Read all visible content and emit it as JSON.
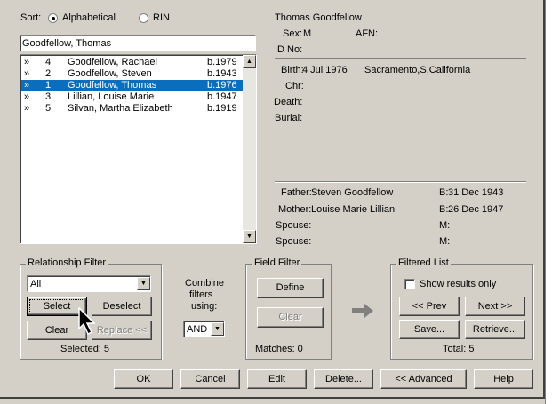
{
  "sort": {
    "label": "Sort:",
    "option_alpha": "Alphabetical",
    "option_rin": "RIN",
    "selected": "Alphabetical"
  },
  "search_value": "Goodfellow, Thomas",
  "list": [
    {
      "marker": "»",
      "rin": "4",
      "name": "Goodfellow, Rachael",
      "birth": "b.1979",
      "selected": false
    },
    {
      "marker": "»",
      "rin": "2",
      "name": "Goodfellow, Steven",
      "birth": "b.1943",
      "selected": false
    },
    {
      "marker": "»",
      "rin": "1",
      "name": "Goodfellow, Thomas",
      "birth": "b.1976",
      "selected": true
    },
    {
      "marker": "»",
      "rin": "3",
      "name": "Lillian, Louise Marie",
      "birth": "b.1947",
      "selected": false
    },
    {
      "marker": "»",
      "rin": "5",
      "name": "Silvan, Martha Elizabeth",
      "birth": "b.1919",
      "selected": false
    }
  ],
  "details": {
    "name": "Thomas Goodfellow",
    "sex_label": "Sex:",
    "sex_value": "M",
    "afn_label": "AFN:",
    "afn_value": "",
    "id_label": "ID No:",
    "id_value": "",
    "birth_label": "Birth:",
    "birth_date": "4 Jul 1976",
    "birth_place": "Sacramento,S,California",
    "chr_label": "Chr:",
    "death_label": "Death:",
    "burial_label": "Burial:",
    "father_label": "Father:",
    "father_value": "Steven Goodfellow",
    "father_b_label": "B:",
    "father_b_value": "31 Dec 1943",
    "mother_label": "Mother:",
    "mother_value": "Louise Marie Lillian",
    "mother_b_label": "B:",
    "mother_b_value": "26 Dec 1947",
    "spouse_label": "Spouse:",
    "m_label": "M:"
  },
  "relationship_filter": {
    "title": "Relationship Filter",
    "dropdown_value": "All",
    "select": "Select",
    "deselect": "Deselect",
    "clear": "Clear",
    "replace": "Replace <<",
    "selected_text": "Selected: 5"
  },
  "combine": {
    "label_line1": "Combine",
    "label_line2": "filters",
    "label_line3": "using:",
    "value": "AND"
  },
  "field_filter": {
    "title": "Field Filter",
    "define": "Define",
    "clear": "Clear",
    "matches": "Matches: 0"
  },
  "filtered_list": {
    "title": "Filtered List",
    "show_results": "Show results only",
    "prev": "<< Prev",
    "next": "Next >>",
    "save": "Save...",
    "retrieve": "Retrieve...",
    "total": "Total: 5"
  },
  "bottom": {
    "ok": "OK",
    "cancel": "Cancel",
    "edit": "Edit",
    "delete": "Delete...",
    "advanced": "<< Advanced",
    "help": "Help"
  },
  "bg_fragments": {
    "a": "S",
    "b": "m",
    "c": "L"
  },
  "colors": {
    "selection": "#0a6ebd",
    "face": "#d4d0c8"
  }
}
